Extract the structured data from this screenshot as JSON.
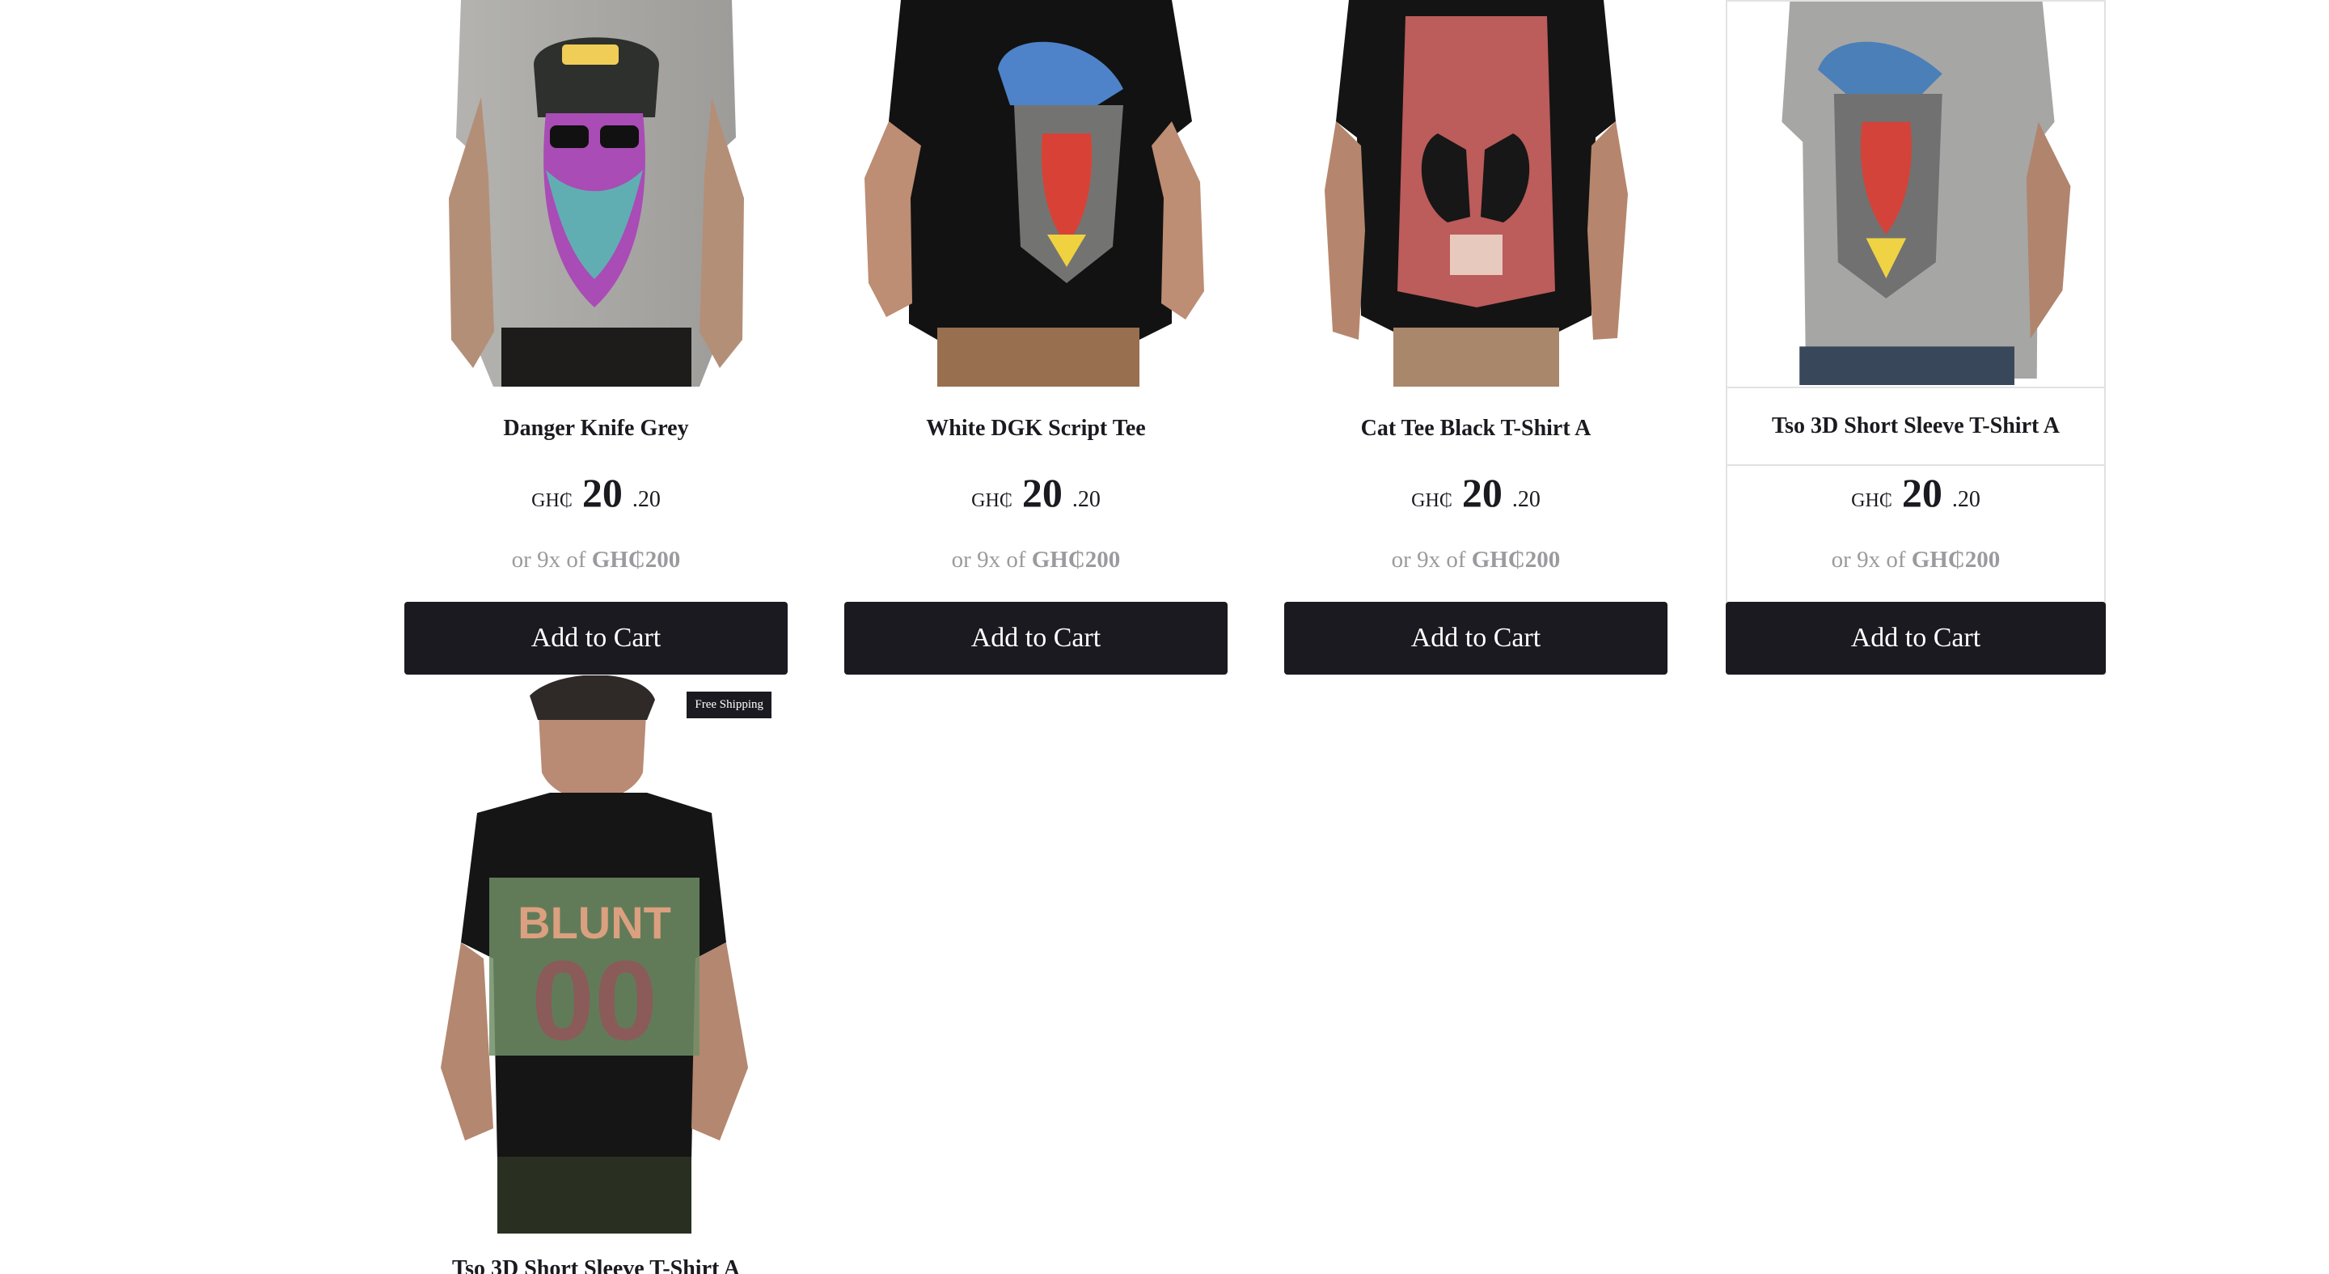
{
  "products": [
    {
      "name": "Danger Knife Grey",
      "currency": "GH₵",
      "price_integer": "20",
      "price_decimal": ".20",
      "installment_prefix": "or 9x of",
      "installment_amount": "GH₵200",
      "button": "Add to Cart",
      "shirt_color": "#a9a8a6",
      "graphic": "bearded-face-graphic"
    },
    {
      "name": "White DGK Script Tee",
      "currency": "GH₵",
      "price_integer": "20",
      "price_decimal": ".20",
      "installment_prefix": "or 9x of",
      "installment_amount": "GH₵200",
      "button": "Add to Cart",
      "shirt_color": "#151515",
      "graphic": "mandrill-graphic"
    },
    {
      "name": "Cat Tee Black T-Shirt A",
      "currency": "GH₵",
      "price_integer": "20",
      "price_decimal": ".20",
      "installment_prefix": "or 9x of",
      "installment_amount": "GH₵200",
      "button": "Add to Cart",
      "shirt_color": "#151515",
      "graphic": "tiger-skull-graphic"
    },
    {
      "name": "Tso 3D Short Sleeve T-Shirt A",
      "currency": "GH₵",
      "price_integer": "20",
      "price_decimal": ".20",
      "installment_prefix": "or 9x of",
      "installment_amount": "GH₵200",
      "button": "Add to Cart",
      "shirt_color": "#a9a8a6",
      "graphic": "mandrill-graphic"
    },
    {
      "name": "Tso 3D Short Sleeve T-Shirt A",
      "badge": "Free Shipping",
      "shirt_color": "#151515",
      "graphic": "floral-blunt-graphic"
    }
  ]
}
